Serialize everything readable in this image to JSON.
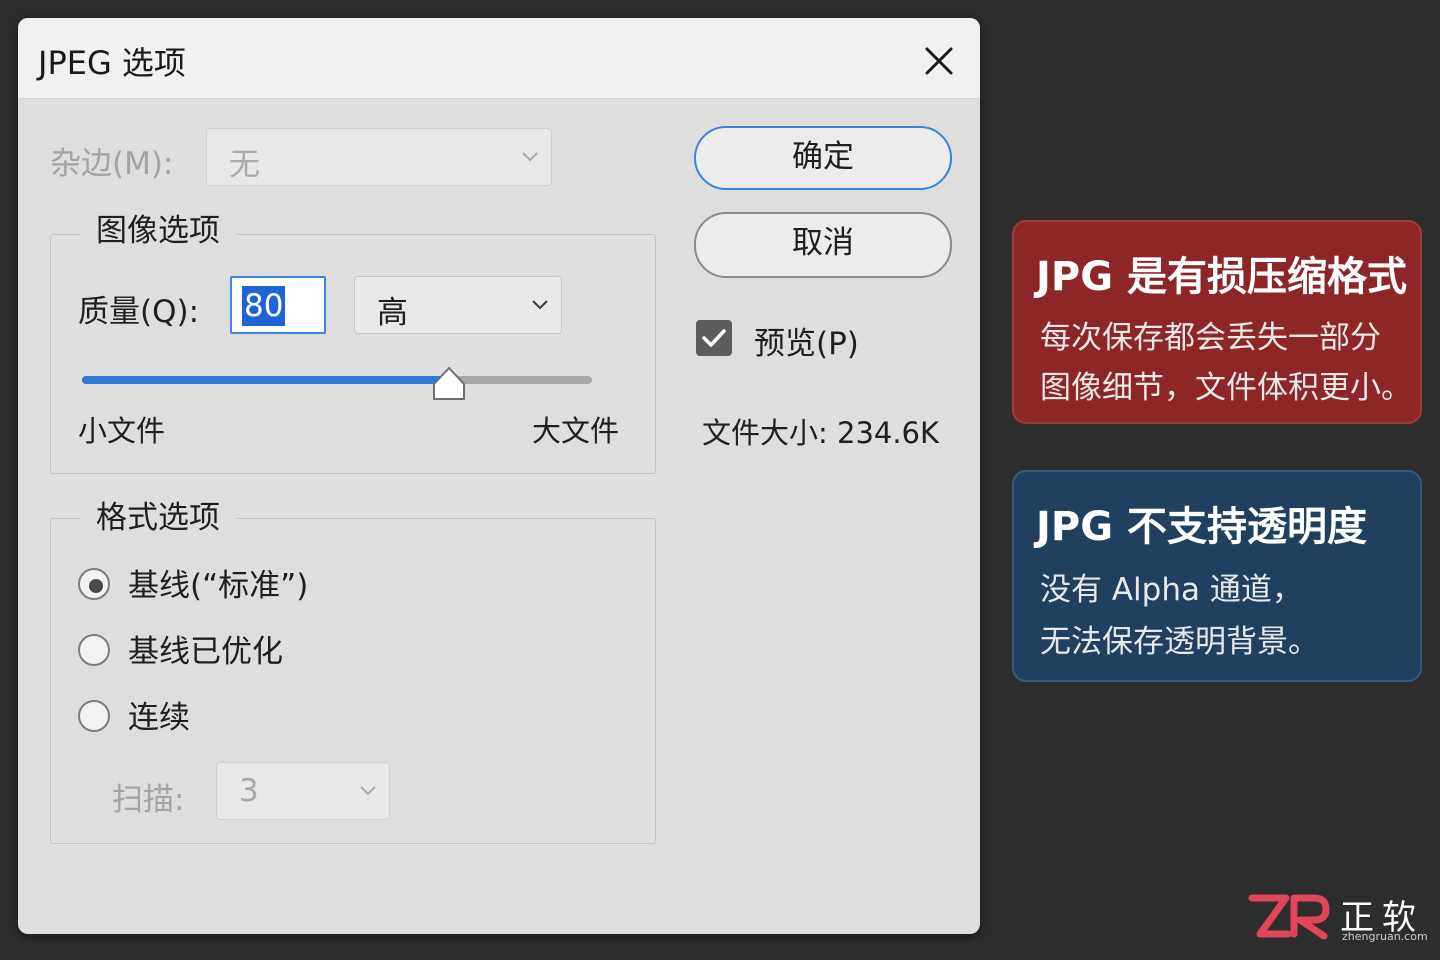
{
  "dialog": {
    "title": "JPEG 选项",
    "matte_label": "杂边(M):",
    "matte_value": "无",
    "image_options": {
      "legend": "图像选项",
      "quality_label": "质量(Q):",
      "quality_value": "80",
      "quality_preset": "高",
      "quality_slider_fraction": 0.72,
      "small_file_label": "小文件",
      "large_file_label": "大文件"
    },
    "format_options": {
      "legend": "格式选项",
      "radios": [
        {
          "label": "基线(“标准”)",
          "checked": true
        },
        {
          "label": "基线已优化",
          "checked": false
        },
        {
          "label": "连续",
          "checked": false
        }
      ],
      "scan_label": "扫描:",
      "scan_value": "3"
    },
    "buttons": {
      "ok": "确定",
      "cancel": "取消"
    },
    "preview": {
      "label": "预览(P)",
      "checked": true
    },
    "filesize_text": "文件大小:  234.6K",
    "icons": [
      "close-icon",
      "chevron-down-icon",
      "checkmark-icon",
      "slider-thumb"
    ]
  },
  "callouts": {
    "lossy": {
      "title": "JPG 是有损压缩格式",
      "line1": "每次保存都会丢失一部分",
      "line2": "图像细节，文件体积更小。"
    },
    "transparency": {
      "title": "JPG 不支持透明度",
      "line1": "没有 Alpha 通道，",
      "line2": "无法保存透明背景。"
    }
  },
  "logo": {
    "name": "正软",
    "site": "zhengruan.com"
  },
  "colors": {
    "accent": "#2f78d8",
    "selection": "#1f63d4",
    "callout_red": "#8d2626",
    "callout_blue": "#21405f",
    "background": "#2d2d2d",
    "dialog": "#dedede",
    "logo_red": "#e0455a"
  }
}
